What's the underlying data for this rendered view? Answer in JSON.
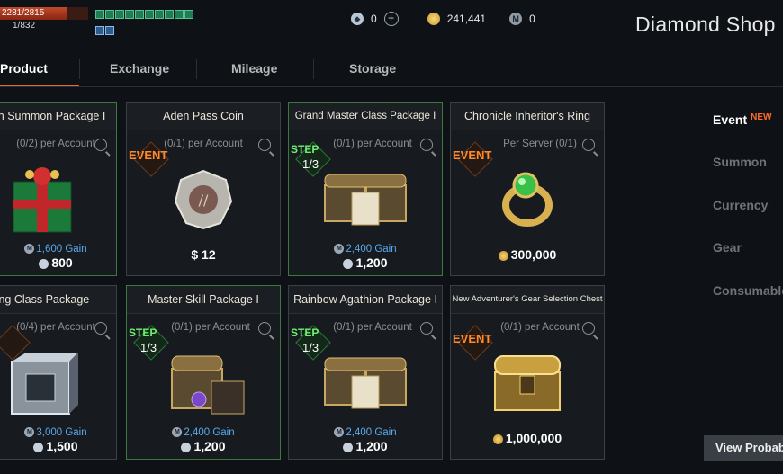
{
  "hud": {
    "hp": "2281/2815",
    "mp": "1/832"
  },
  "currency": {
    "diamond": "0",
    "adena": "241,441",
    "mileage": "0"
  },
  "shop_title": "Diamond Shop",
  "tabs": [
    "Product",
    "Exchange",
    "Mileage",
    "Storage"
  ],
  "categories": {
    "event": "Event",
    "new_badge": "NEW",
    "summon": "Summon",
    "currency": "Currency",
    "gear": "Gear",
    "consumable": "Consumable"
  },
  "view_probability": "View Probab",
  "cards": [
    {
      "title": "athion Summon Package I",
      "limit": "(0/2) per Account",
      "badge": "",
      "gain": "1,600",
      "gain_suffix": "Gain",
      "price": "800"
    },
    {
      "title": "Aden Pass Coin",
      "limit": "(0/1) per Account",
      "badge": "EVENT",
      "price": "$ 12"
    },
    {
      "title": "Grand Master Class Package I",
      "limit": "(0/1) per Account",
      "badge": "STEP",
      "badge_sub": "1/3",
      "gain": "2,400",
      "gain_suffix": "Gain",
      "price": "1,200"
    },
    {
      "title": "Chronicle Inheritor's Ring",
      "limit": "Per Server (0/1)",
      "badge": "EVENT",
      "price": "300,000"
    },
    {
      "title": "ning Class Package",
      "limit": "(0/4) per Account",
      "badge": "T",
      "gain": "3,000",
      "gain_suffix": "Gain",
      "price": "1,500"
    },
    {
      "title": "Master Skill Package I",
      "limit": "(0/1) per Account",
      "badge": "STEP",
      "badge_sub": "1/3",
      "gain": "2,400",
      "gain_suffix": "Gain",
      "price": "1,200"
    },
    {
      "title": "Rainbow Agathion Package I",
      "limit": "(0/1) per Account",
      "badge": "STEP",
      "badge_sub": "1/3",
      "gain": "2,400",
      "gain_suffix": "Gain",
      "price": "1,200"
    },
    {
      "title": "New Adventurer's Gear Selection Chest",
      "limit": "(0/1) per Account",
      "badge": "EVENT",
      "price": "1,000,000"
    }
  ],
  "colors": {
    "accent": "#e86a2a",
    "event": "#ff8a2a",
    "step": "#6ef070",
    "gain": "#5ba8ea",
    "green_border": "#3b7a3c"
  }
}
